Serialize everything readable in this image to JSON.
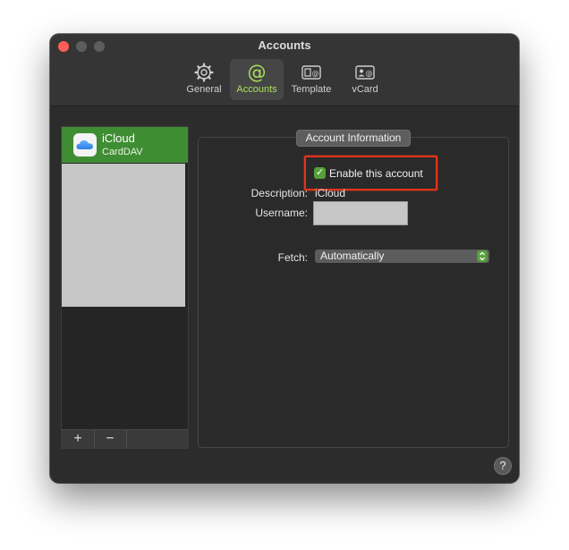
{
  "window": {
    "title": "Accounts"
  },
  "tabs": [
    {
      "label": "General",
      "icon": "gear-icon"
    },
    {
      "label": "Accounts",
      "icon": "at-sign-icon",
      "selected": true
    },
    {
      "label": "Template",
      "icon": "template-icon"
    },
    {
      "label": "vCard",
      "icon": "vcard-icon"
    }
  ],
  "accounts_list": {
    "items": [
      {
        "name": "iCloud",
        "type": "CardDAV",
        "icon": "icloud-icon"
      }
    ],
    "add_label": "+",
    "remove_label": "−"
  },
  "account_info": {
    "title": "Account Information",
    "enable_label": "Enable this account",
    "enabled": true,
    "description_label": "Description:",
    "description_value": "iCloud",
    "username_label": "Username:",
    "fetch_label": "Fetch:",
    "fetch_value": "Automatically"
  },
  "help": {
    "label": "?"
  },
  "colors": {
    "accent": "#3f8d33",
    "highlight": "#e0341c"
  }
}
